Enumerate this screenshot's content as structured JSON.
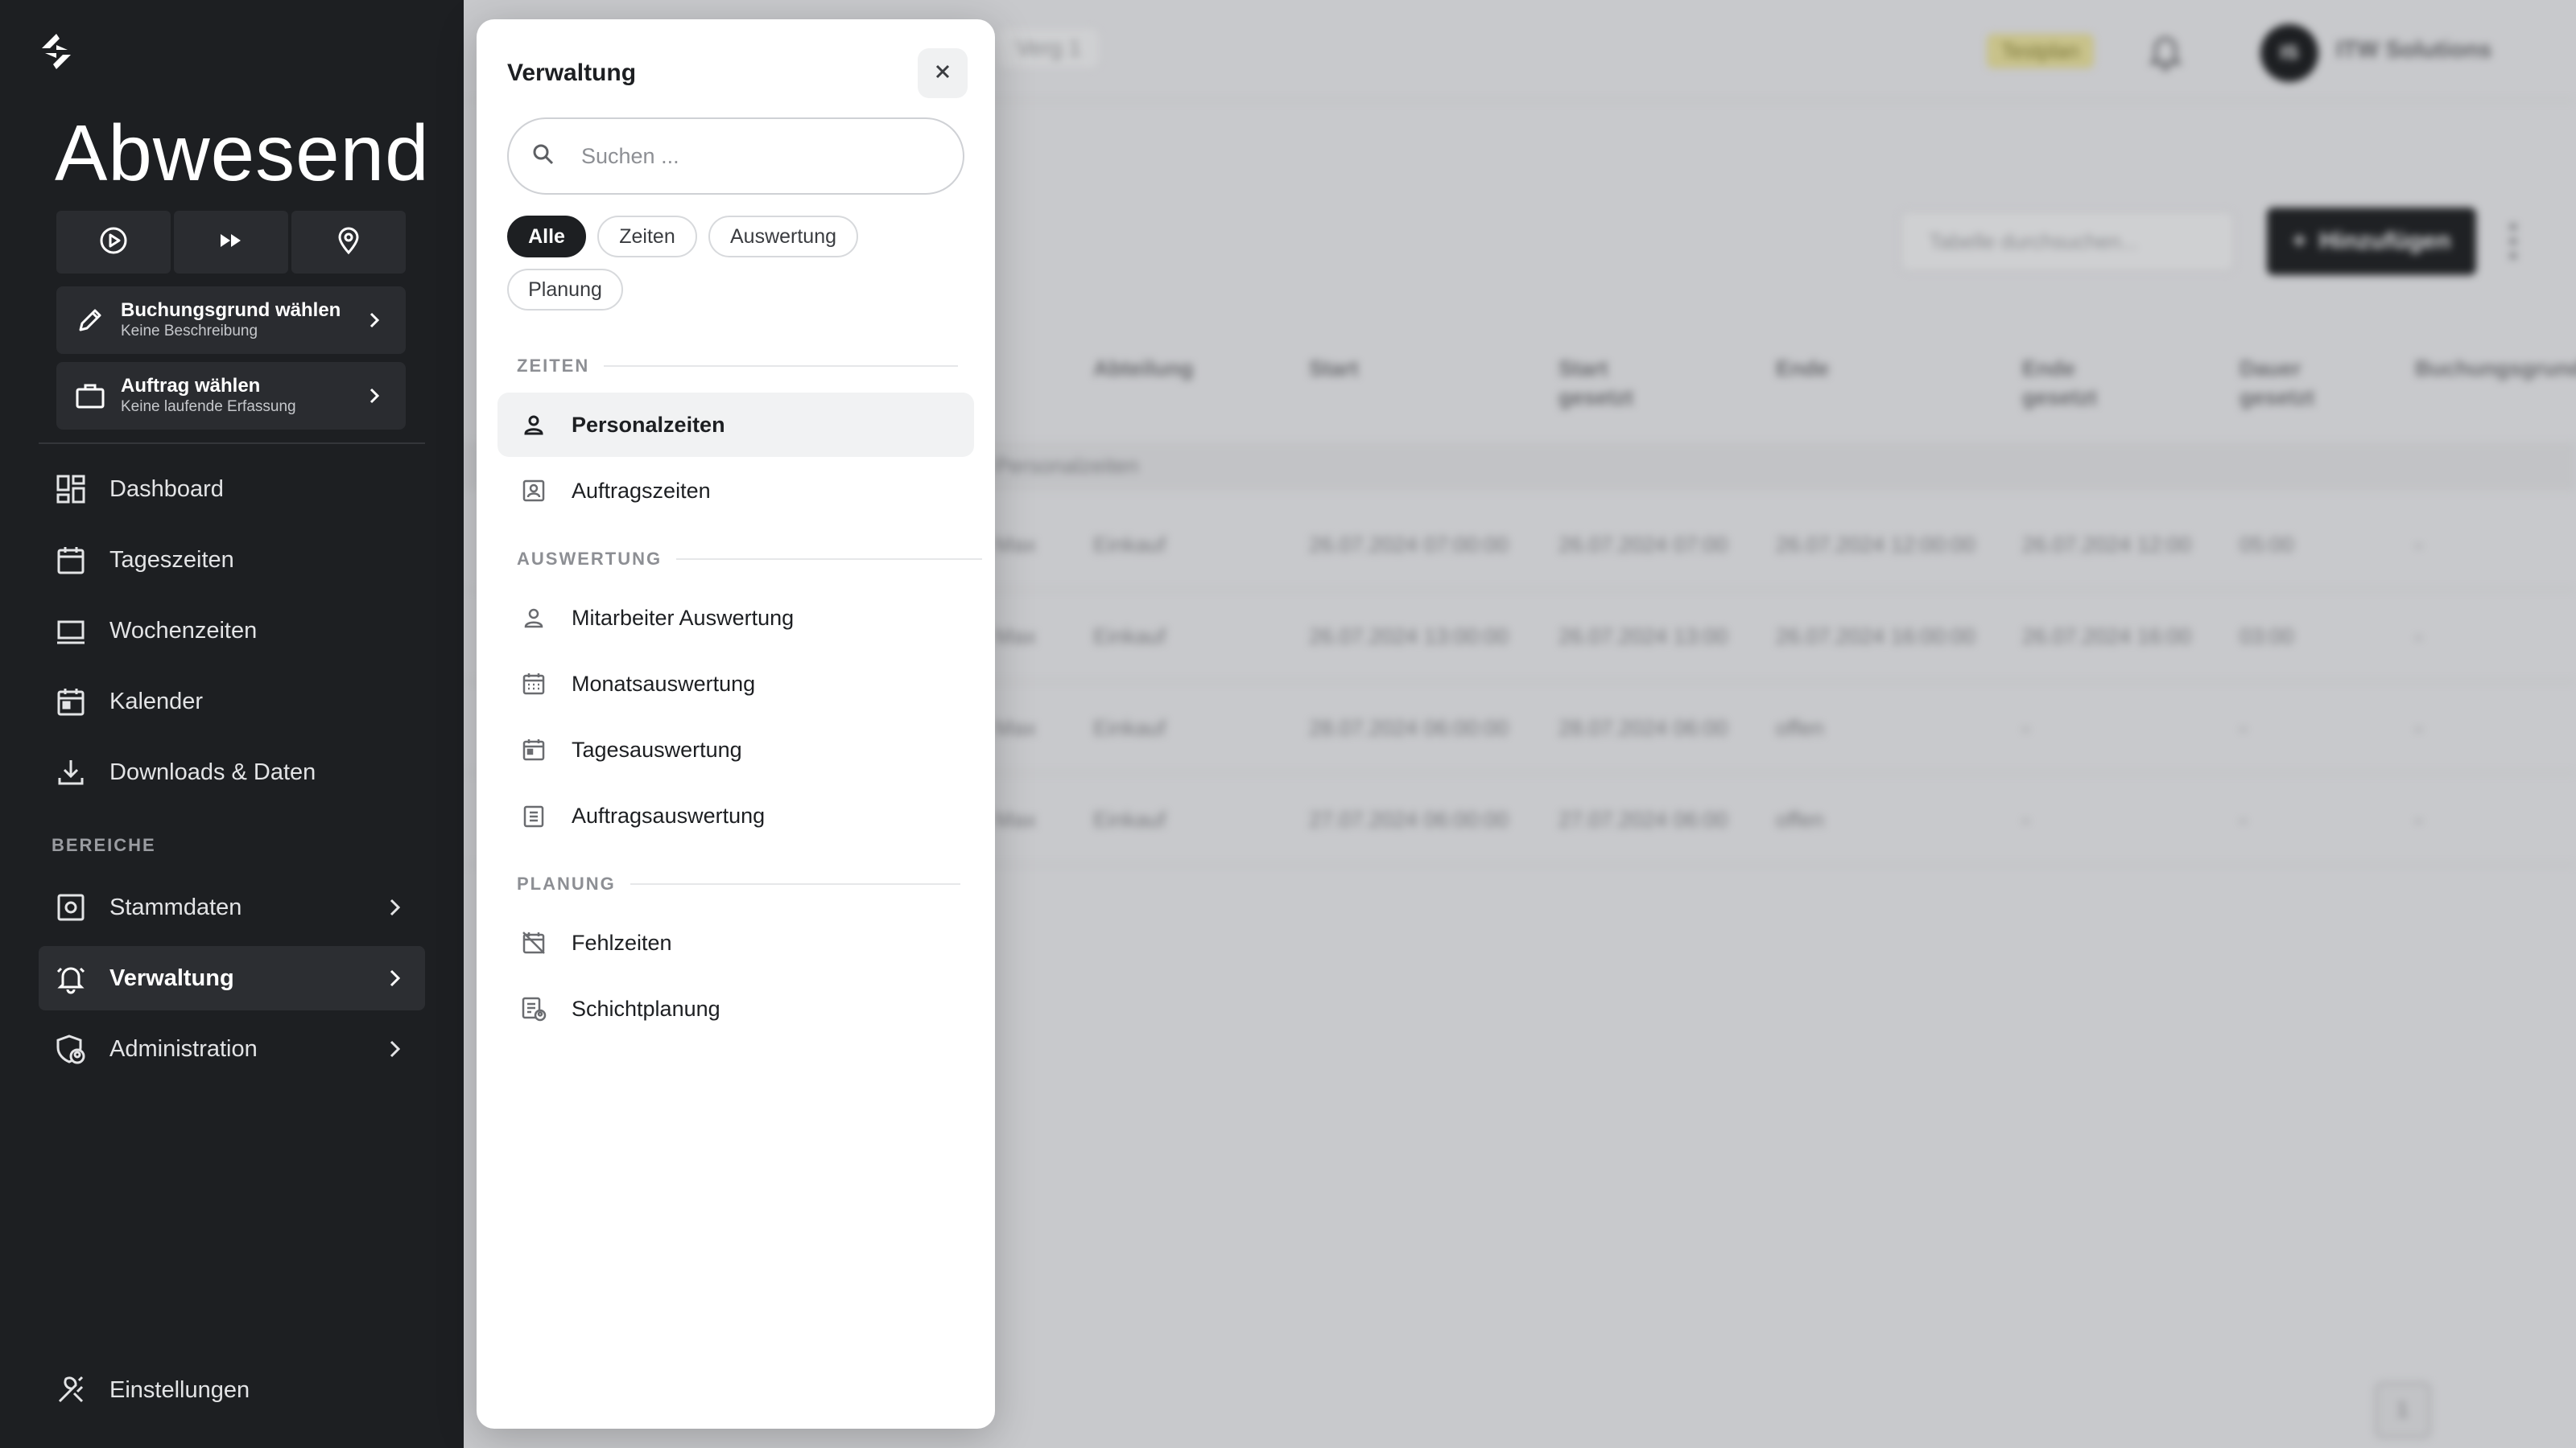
{
  "sidebar": {
    "status": "Abwesend",
    "quick_actions": [
      {
        "icon": "play-circle-icon"
      },
      {
        "icon": "fast-forward-icon"
      },
      {
        "icon": "map-pin-icon"
      }
    ],
    "booking_card": {
      "title": "Buchungsgrund wählen",
      "subtitle": "Keine Beschreibung"
    },
    "order_card": {
      "title": "Auftrag wählen",
      "subtitle": "Keine laufende Erfassung"
    },
    "nav": [
      {
        "label": "Dashboard",
        "icon": "dashboard-icon"
      },
      {
        "label": "Tageszeiten",
        "icon": "calendar-icon"
      },
      {
        "label": "Wochenzeiten",
        "icon": "week-view-icon"
      },
      {
        "label": "Kalender",
        "icon": "calendar-day-icon"
      },
      {
        "label": "Downloads & Daten",
        "icon": "download-icon"
      }
    ],
    "section_label": "BEREICHE",
    "areas": [
      {
        "label": "Stammdaten",
        "icon": "master-data-icon"
      },
      {
        "label": "Verwaltung",
        "icon": "bell-icon",
        "active": true
      },
      {
        "label": "Administration",
        "icon": "shield-user-icon"
      }
    ],
    "settings": {
      "label": "Einstellungen",
      "icon": "tools-icon"
    }
  },
  "background": {
    "breadcrumb": "Verg 1",
    "badge": "Testplan",
    "avatar_initials": "IS",
    "company": "ITW Solutions",
    "table_search_placeholder": "Tabelle durchsuchen...",
    "add_button": "Hinzufügen",
    "columns": [
      "Abteilung",
      "Start",
      "Start gesetzt",
      "Ende",
      "Ende gesetzt",
      "Dauer gesetzt",
      "Buchungsgrund"
    ],
    "group_label": "Personalzeiten",
    "rows": [
      [
        "Max",
        "Einkauf",
        "26.07.2024 07:00:00",
        "26.07.2024 07:00",
        "26.07.2024 12:00:00",
        "26.07.2024 12:00",
        "05:00",
        "-"
      ],
      [
        "Max",
        "Einkauf",
        "26.07.2024 13:00:00",
        "26.07.2024 13:00",
        "26.07.2024 16:00:00",
        "26.07.2024 16:00",
        "03:00",
        "-"
      ],
      [
        "Max",
        "Einkauf",
        "28.07.2024 06:00:00",
        "28.07.2024 06:00",
        "offen",
        "-",
        "-",
        "-"
      ],
      [
        "Max",
        "Einkauf",
        "27.07.2024 06:00:00",
        "27.07.2024 06:00",
        "offen",
        "-",
        "-",
        "-"
      ]
    ],
    "page": "1"
  },
  "panel": {
    "title": "Verwaltung",
    "search_placeholder": "Suchen ...",
    "filters": [
      "Alle",
      "Zeiten",
      "Auswertung",
      "Planung"
    ],
    "sections": [
      {
        "label": "ZEITEN",
        "items": [
          {
            "label": "Personalzeiten",
            "icon": "person-icon",
            "active": true
          },
          {
            "label": "Auftragszeiten",
            "icon": "person-badge-icon"
          }
        ]
      },
      {
        "label": "AUSWERTUNG",
        "items": [
          {
            "label": "Mitarbeiter Auswertung",
            "icon": "person-icon"
          },
          {
            "label": "Monatsauswertung",
            "icon": "calendar-month-icon"
          },
          {
            "label": "Tagesauswertung",
            "icon": "calendar-day-icon"
          },
          {
            "label": "Auftragsauswertung",
            "icon": "clipboard-list-icon"
          }
        ]
      },
      {
        "label": "PLANUNG",
        "items": [
          {
            "label": "Fehlzeiten",
            "icon": "calendar-off-icon"
          },
          {
            "label": "Schichtplanung",
            "icon": "schedule-user-icon"
          }
        ]
      }
    ]
  }
}
